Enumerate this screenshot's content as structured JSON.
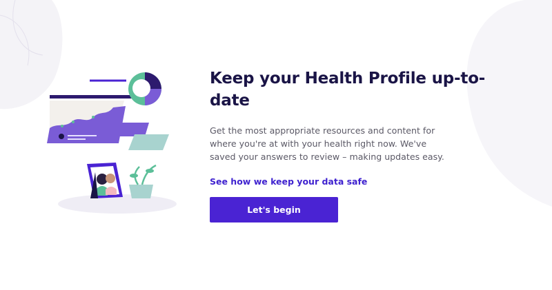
{
  "onboarding": {
    "title": "Keep your Health Profile up-to-date",
    "description": "Get the most appropriate resources and content for where you're at with your health right now. We've saved your answers to review – making updates easy.",
    "privacy_link": "See how we keep your data safe",
    "begin_button": "Let's begin"
  },
  "colors": {
    "primary": "#4a23d3",
    "link": "#3f22cf",
    "heading": "#1a1446",
    "body_text": "#5b5966",
    "illustration_purple": "#7a5cd6",
    "illustration_green": "#5cbf99",
    "illustration_teal": "#a8d3cf"
  },
  "icons": {
    "illustration": "health-profile-illustration"
  }
}
